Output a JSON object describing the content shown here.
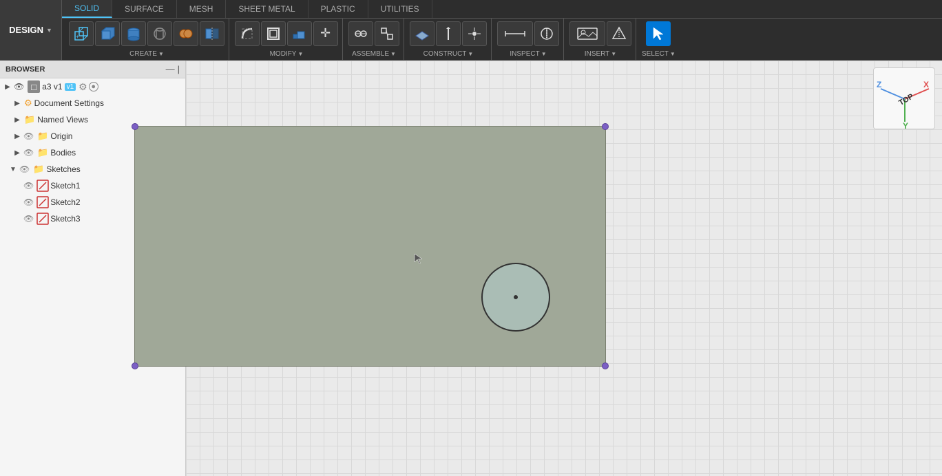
{
  "design_btn": {
    "label": "DESIGN",
    "chevron": "▼"
  },
  "tabs": [
    {
      "id": "solid",
      "label": "SOLID",
      "active": true
    },
    {
      "id": "surface",
      "label": "SURFACE",
      "active": false
    },
    {
      "id": "mesh",
      "label": "MESH",
      "active": false
    },
    {
      "id": "sheet_metal",
      "label": "SHEET METAL",
      "active": false
    },
    {
      "id": "plastic",
      "label": "PLASTIC",
      "active": false
    },
    {
      "id": "utilities",
      "label": "UTILITIES",
      "active": false
    }
  ],
  "toolbar_groups": [
    {
      "id": "create",
      "label": "CREATE",
      "has_arrow": true,
      "icons": [
        "new-component",
        "box",
        "revolve",
        "hole",
        "combine",
        "mirror"
      ]
    },
    {
      "id": "modify",
      "label": "MODIFY",
      "has_arrow": true,
      "icons": [
        "fillet",
        "shell",
        "scale",
        "combine2"
      ]
    },
    {
      "id": "assemble",
      "label": "ASSEMBLE",
      "has_arrow": true,
      "icons": [
        "joint",
        "rigid-group"
      ]
    },
    {
      "id": "construct",
      "label": "CONSTRUCT",
      "has_arrow": true,
      "icons": [
        "plane",
        "axis",
        "point"
      ]
    },
    {
      "id": "inspect",
      "label": "INSPECT",
      "has_arrow": true,
      "icons": [
        "measure",
        "section"
      ]
    },
    {
      "id": "insert",
      "label": "INSERT",
      "has_arrow": true,
      "icons": [
        "insert-image",
        "insert-mesh"
      ]
    },
    {
      "id": "select",
      "label": "SELECT",
      "has_arrow": true,
      "icons": [
        "select-tool"
      ],
      "active": true
    }
  ],
  "construct_label": "CONSTRUCT >",
  "browser": {
    "title": "BROWSER",
    "collapse_icon": "—",
    "expand_icon": "|"
  },
  "tree": [
    {
      "id": "a3v1",
      "type": "root",
      "label": "a3 v1",
      "version_badge": "v1",
      "has_eye": true,
      "has_arrow": true,
      "arrow": "▶",
      "indent": 0
    },
    {
      "id": "doc-settings",
      "type": "settings",
      "label": "Document Settings",
      "has_eye": false,
      "has_arrow": true,
      "arrow": "▶",
      "indent": 1
    },
    {
      "id": "named-views",
      "type": "folder",
      "label": "Named Views",
      "has_eye": false,
      "has_arrow": true,
      "arrow": "▶",
      "indent": 1
    },
    {
      "id": "origin",
      "type": "folder",
      "label": "Origin",
      "has_eye": true,
      "has_arrow": true,
      "arrow": "▶",
      "indent": 1
    },
    {
      "id": "bodies",
      "type": "folder",
      "label": "Bodies",
      "has_eye": true,
      "has_arrow": true,
      "arrow": "▶",
      "indent": 1
    },
    {
      "id": "sketches",
      "type": "folder",
      "label": "Sketches",
      "has_eye": true,
      "has_arrow": true,
      "arrow": "▼",
      "indent": 1
    },
    {
      "id": "sketch1",
      "type": "sketch",
      "label": "Sketch1",
      "has_eye": true,
      "has_arrow": false,
      "indent": 2
    },
    {
      "id": "sketch2",
      "type": "sketch",
      "label": "Sketch2",
      "has_eye": true,
      "has_arrow": false,
      "indent": 2
    },
    {
      "id": "sketch3",
      "type": "sketch",
      "label": "Sketch3",
      "has_eye": true,
      "has_arrow": false,
      "indent": 2
    }
  ],
  "axis": {
    "x_label": "X",
    "y_label": "Y",
    "z_label": "Z",
    "view_label": "TOP"
  },
  "icons": {
    "eye_open": "👁",
    "eye_closed": "🚫",
    "folder_yellow": "📁",
    "folder_gray": "🗁",
    "settings_gear": "⚙",
    "arrow_right": "▶",
    "arrow_down": "▼"
  }
}
